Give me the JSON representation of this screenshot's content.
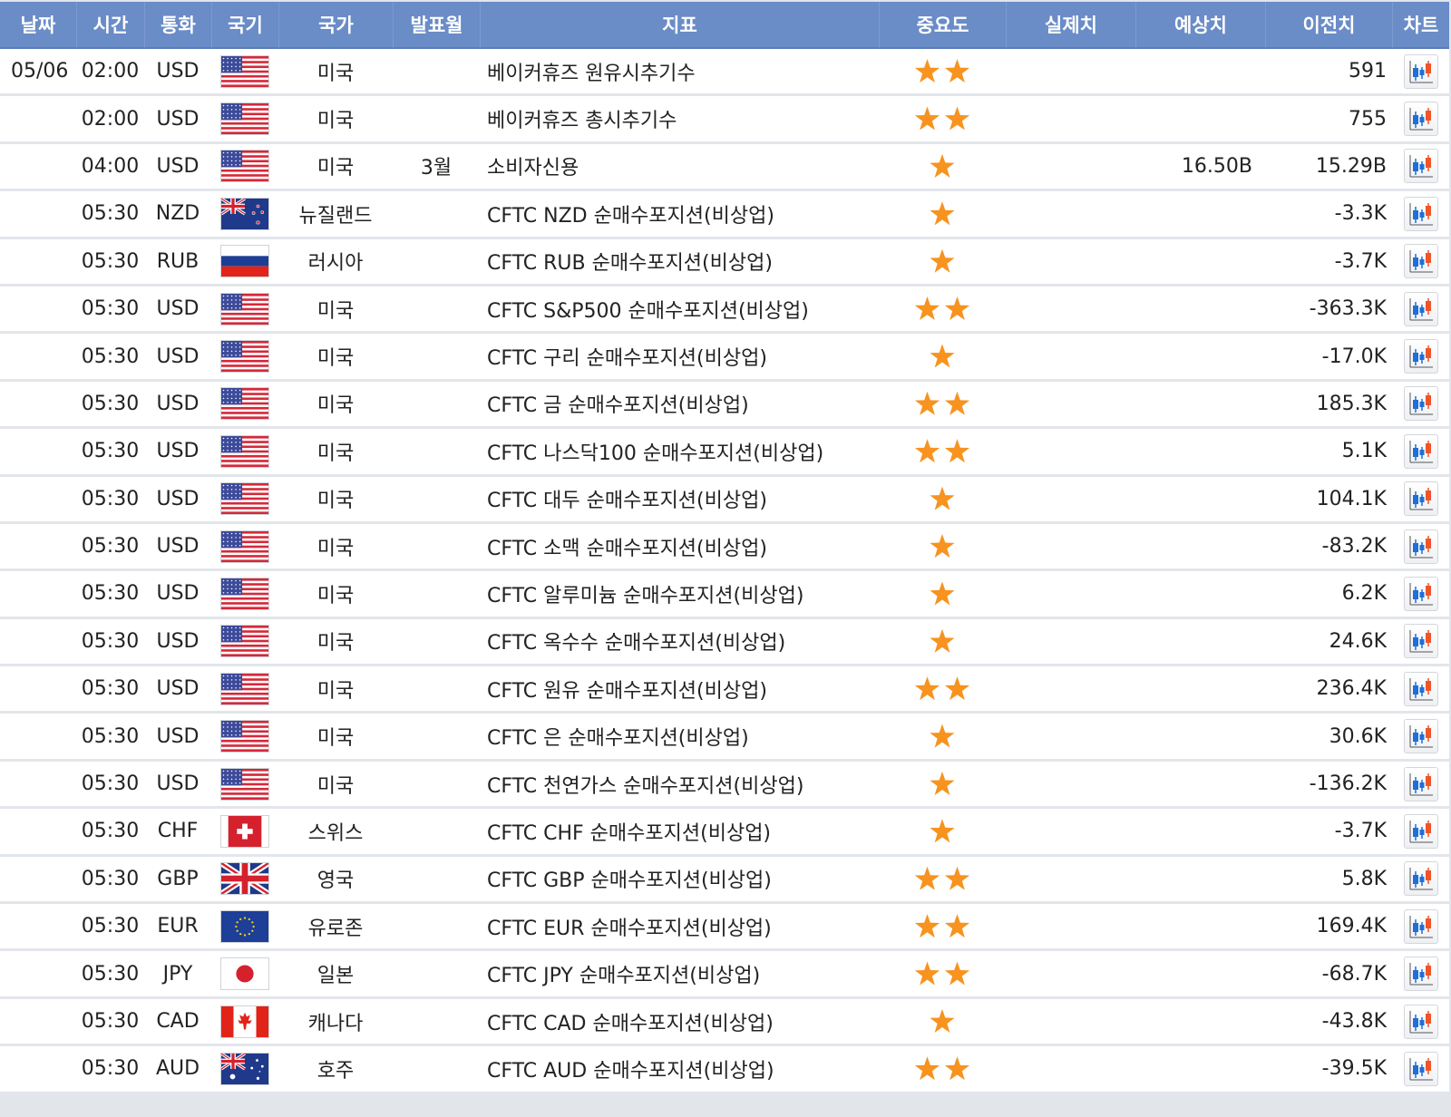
{
  "header": {
    "date": "날짜",
    "time": "시간",
    "currency": "통화",
    "flag": "국기",
    "country": "국가",
    "month": "발표월",
    "indicator": "지표",
    "importance": "중요도",
    "actual": "실제치",
    "forecast": "예상치",
    "previous": "이전치",
    "chart": "차트"
  },
  "colors": {
    "header_bg": "#6a8cc7",
    "star": "#f7931e",
    "row_bg": "#ffffff",
    "divider": "#e2e5ea"
  },
  "rows": [
    {
      "date": "05/06",
      "time": "02:00",
      "currency": "USD",
      "flag": "us-flag-icon",
      "country": "미국",
      "month": "",
      "indicator": "베이커휴즈 원유시추기수",
      "importance": 2,
      "actual": "",
      "forecast": "",
      "previous": "591"
    },
    {
      "date": "",
      "time": "02:00",
      "currency": "USD",
      "flag": "us-flag-icon",
      "country": "미국",
      "month": "",
      "indicator": "베이커휴즈 총시추기수",
      "importance": 2,
      "actual": "",
      "forecast": "",
      "previous": "755"
    },
    {
      "date": "",
      "time": "04:00",
      "currency": "USD",
      "flag": "us-flag-icon",
      "country": "미국",
      "month": "3월",
      "indicator": "소비자신용",
      "importance": 1,
      "actual": "",
      "forecast": "16.50B",
      "previous": "15.29B"
    },
    {
      "date": "",
      "time": "05:30",
      "currency": "NZD",
      "flag": "nz-flag-icon",
      "country": "뉴질랜드",
      "month": "",
      "indicator": "CFTC NZD 순매수포지션(비상업)",
      "importance": 1,
      "actual": "",
      "forecast": "",
      "previous": "-3.3K"
    },
    {
      "date": "",
      "time": "05:30",
      "currency": "RUB",
      "flag": "ru-flag-icon",
      "country": "러시아",
      "month": "",
      "indicator": "CFTC RUB 순매수포지션(비상업)",
      "importance": 1,
      "actual": "",
      "forecast": "",
      "previous": "-3.7K"
    },
    {
      "date": "",
      "time": "05:30",
      "currency": "USD",
      "flag": "us-flag-icon",
      "country": "미국",
      "month": "",
      "indicator": "CFTC S&P500 순매수포지션(비상업)",
      "importance": 2,
      "actual": "",
      "forecast": "",
      "previous": "-363.3K"
    },
    {
      "date": "",
      "time": "05:30",
      "currency": "USD",
      "flag": "us-flag-icon",
      "country": "미국",
      "month": "",
      "indicator": "CFTC 구리 순매수포지션(비상업)",
      "importance": 1,
      "actual": "",
      "forecast": "",
      "previous": "-17.0K"
    },
    {
      "date": "",
      "time": "05:30",
      "currency": "USD",
      "flag": "us-flag-icon",
      "country": "미국",
      "month": "",
      "indicator": "CFTC 금 순매수포지션(비상업)",
      "importance": 2,
      "actual": "",
      "forecast": "",
      "previous": "185.3K"
    },
    {
      "date": "",
      "time": "05:30",
      "currency": "USD",
      "flag": "us-flag-icon",
      "country": "미국",
      "month": "",
      "indicator": "CFTC 나스닥100 순매수포지션(비상업)",
      "importance": 2,
      "actual": "",
      "forecast": "",
      "previous": "5.1K"
    },
    {
      "date": "",
      "time": "05:30",
      "currency": "USD",
      "flag": "us-flag-icon",
      "country": "미국",
      "month": "",
      "indicator": "CFTC 대두 순매수포지션(비상업)",
      "importance": 1,
      "actual": "",
      "forecast": "",
      "previous": "104.1K"
    },
    {
      "date": "",
      "time": "05:30",
      "currency": "USD",
      "flag": "us-flag-icon",
      "country": "미국",
      "month": "",
      "indicator": "CFTC 소맥 순매수포지션(비상업)",
      "importance": 1,
      "actual": "",
      "forecast": "",
      "previous": "-83.2K"
    },
    {
      "date": "",
      "time": "05:30",
      "currency": "USD",
      "flag": "us-flag-icon",
      "country": "미국",
      "month": "",
      "indicator": "CFTC 알루미늄 순매수포지션(비상업)",
      "importance": 1,
      "actual": "",
      "forecast": "",
      "previous": "6.2K"
    },
    {
      "date": "",
      "time": "05:30",
      "currency": "USD",
      "flag": "us-flag-icon",
      "country": "미국",
      "month": "",
      "indicator": "CFTC 옥수수 순매수포지션(비상업)",
      "importance": 1,
      "actual": "",
      "forecast": "",
      "previous": "24.6K"
    },
    {
      "date": "",
      "time": "05:30",
      "currency": "USD",
      "flag": "us-flag-icon",
      "country": "미국",
      "month": "",
      "indicator": "CFTC 원유 순매수포지션(비상업)",
      "importance": 2,
      "actual": "",
      "forecast": "",
      "previous": "236.4K"
    },
    {
      "date": "",
      "time": "05:30",
      "currency": "USD",
      "flag": "us-flag-icon",
      "country": "미국",
      "month": "",
      "indicator": "CFTC 은 순매수포지션(비상업)",
      "importance": 1,
      "actual": "",
      "forecast": "",
      "previous": "30.6K"
    },
    {
      "date": "",
      "time": "05:30",
      "currency": "USD",
      "flag": "us-flag-icon",
      "country": "미국",
      "month": "",
      "indicator": "CFTC 천연가스 순매수포지션(비상업)",
      "importance": 1,
      "actual": "",
      "forecast": "",
      "previous": "-136.2K"
    },
    {
      "date": "",
      "time": "05:30",
      "currency": "CHF",
      "flag": "ch-flag-icon",
      "country": "스위스",
      "month": "",
      "indicator": "CFTC CHF 순매수포지션(비상업)",
      "importance": 1,
      "actual": "",
      "forecast": "",
      "previous": "-3.7K"
    },
    {
      "date": "",
      "time": "05:30",
      "currency": "GBP",
      "flag": "gb-flag-icon",
      "country": "영국",
      "month": "",
      "indicator": "CFTC GBP 순매수포지션(비상업)",
      "importance": 2,
      "actual": "",
      "forecast": "",
      "previous": "5.8K"
    },
    {
      "date": "",
      "time": "05:30",
      "currency": "EUR",
      "flag": "eu-flag-icon",
      "country": "유로존",
      "month": "",
      "indicator": "CFTC EUR 순매수포지션(비상업)",
      "importance": 2,
      "actual": "",
      "forecast": "",
      "previous": "169.4K"
    },
    {
      "date": "",
      "time": "05:30",
      "currency": "JPY",
      "flag": "jp-flag-icon",
      "country": "일본",
      "month": "",
      "indicator": "CFTC JPY 순매수포지션(비상업)",
      "importance": 2,
      "actual": "",
      "forecast": "",
      "previous": "-68.7K"
    },
    {
      "date": "",
      "time": "05:30",
      "currency": "CAD",
      "flag": "ca-flag-icon",
      "country": "캐나다",
      "month": "",
      "indicator": "CFTC CAD 순매수포지션(비상업)",
      "importance": 1,
      "actual": "",
      "forecast": "",
      "previous": "-43.8K"
    },
    {
      "date": "",
      "time": "05:30",
      "currency": "AUD",
      "flag": "au-flag-icon",
      "country": "호주",
      "month": "",
      "indicator": "CFTC AUD 순매수포지션(비상업)",
      "importance": 2,
      "actual": "",
      "forecast": "",
      "previous": "-39.5K"
    }
  ]
}
